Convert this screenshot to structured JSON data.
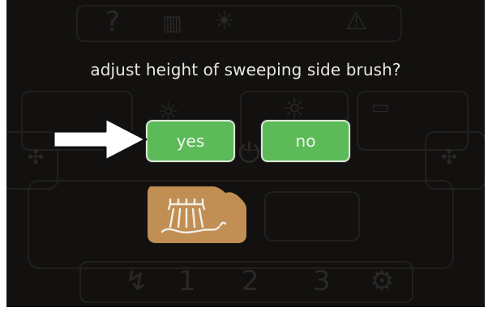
{
  "dialog": {
    "question": "adjust height of sweeping side brush?",
    "yes_label": "yes",
    "no_label": "no"
  },
  "background": {
    "top_icons": [
      "help-icon",
      "battery-icon",
      "sun-icon",
      "warning-icon"
    ],
    "bottom_numbers": [
      "1",
      "2",
      "3"
    ],
    "bottom_icons": [
      "brush-level-icon",
      "settings-icon"
    ]
  },
  "colors": {
    "screen_bg": "#121110",
    "button_green": "#5cba59",
    "button_border": "#dbe8d6",
    "brush_tile": "#c18e53",
    "text": "#e9e7e3"
  },
  "pointer": {
    "icon": "arrow-right-icon"
  }
}
